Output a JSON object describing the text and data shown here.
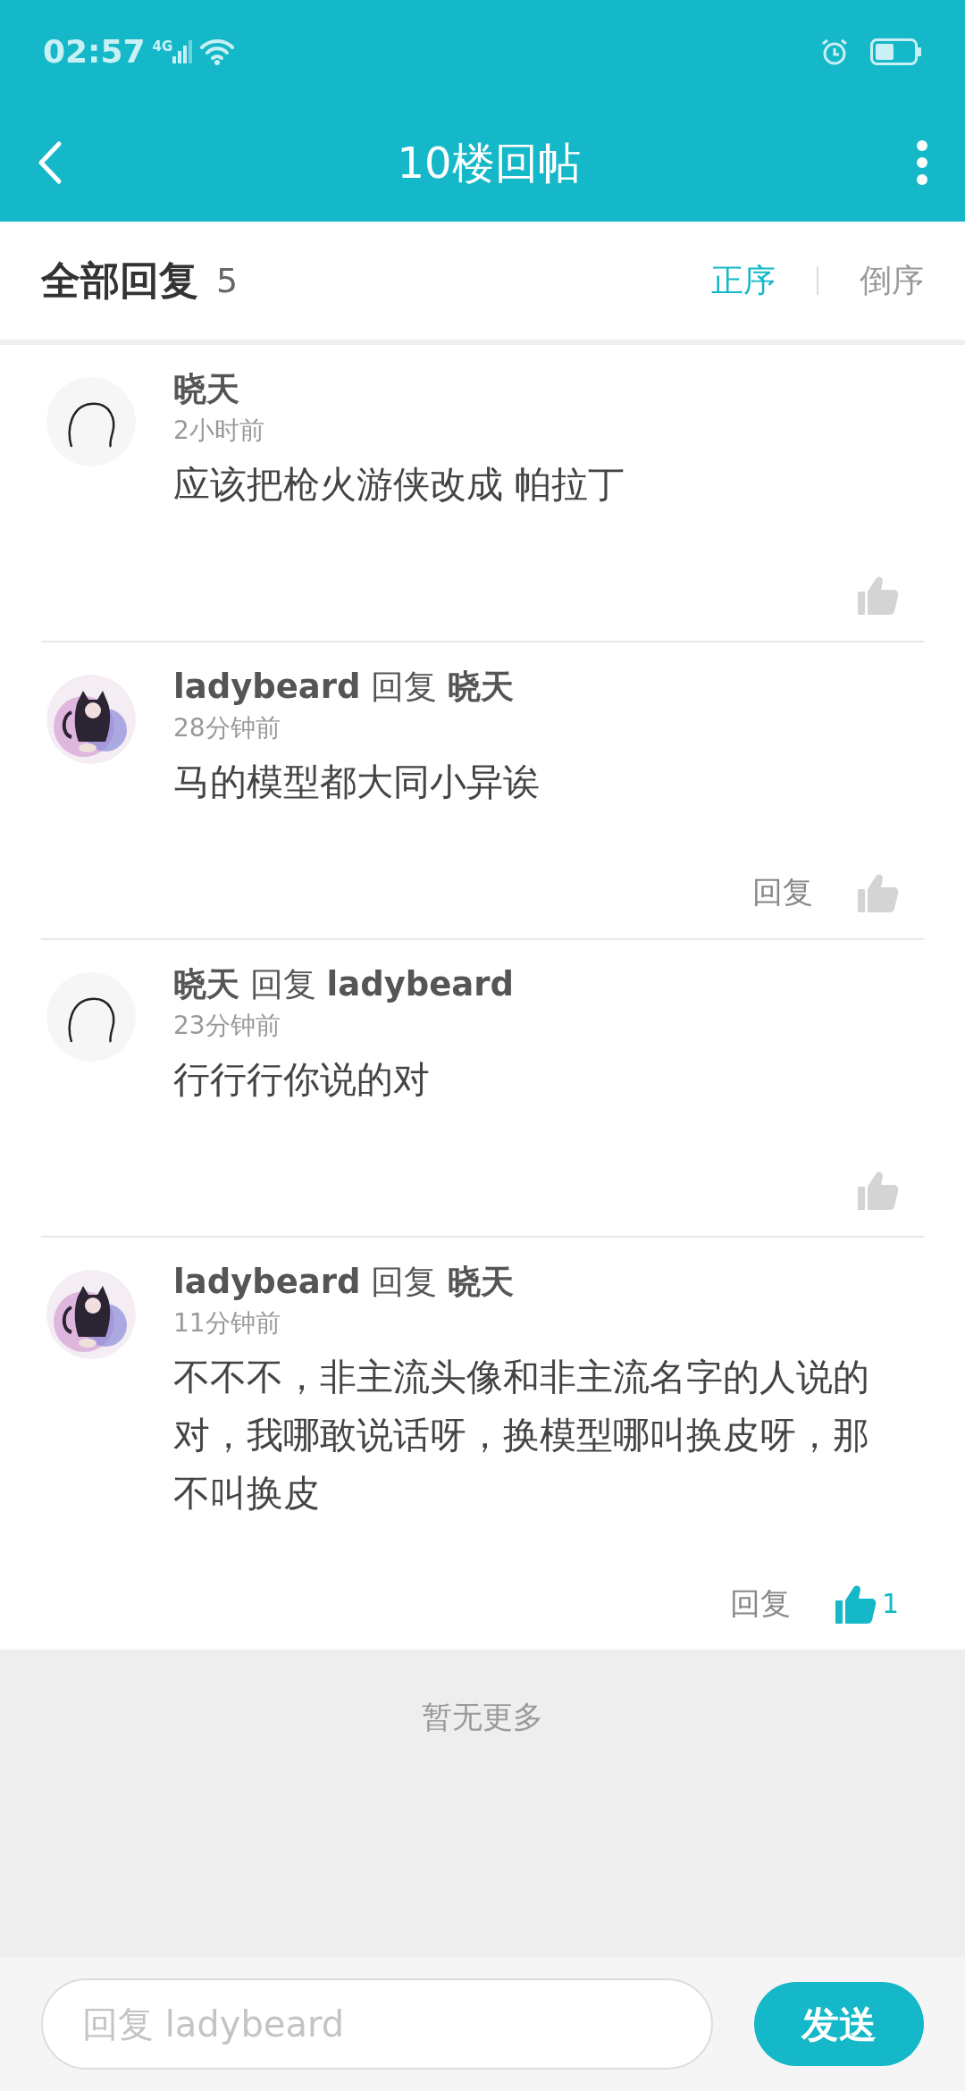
{
  "status_bar": {
    "time": "02:57",
    "network": "4G"
  },
  "app_bar": {
    "title": "10楼回帖"
  },
  "header": {
    "title": "全部回复",
    "count": "5",
    "sort_tabs": [
      {
        "label": "正序",
        "selected": true
      },
      {
        "label": "倒序",
        "selected": false
      }
    ]
  },
  "comments": [
    {
      "avatar": {
        "kind": "sketch"
      },
      "author": "晓天",
      "time": "2小时前",
      "text": "应该把枪火游侠改成  帕拉丁",
      "like": {
        "liked": false
      }
    },
    {
      "author": "ladybeard",
      "reply_word": "回复",
      "reply_to": "晓天",
      "time": "28分钟前",
      "text": "马的模型都大同小异诶",
      "reply_button": "回复",
      "like": {
        "liked": false
      }
    },
    {
      "avatar": {
        "kind": "sketch"
      },
      "author": "晓天",
      "reply_word": "回复",
      "reply_to": "ladybeard",
      "time": "23分钟前",
      "text": "行行行你说的对",
      "like": {
        "liked": false
      }
    },
    {
      "author": "ladybeard",
      "reply_word": "回复",
      "reply_to": "晓天",
      "time": "11分钟前",
      "text": "不不不，非主流头像和非主流名字的人说的对，我哪敢说话呀，换模型哪叫换皮呀，那不叫换皮",
      "reply_button": "回复",
      "like": {
        "liked": true,
        "count": "1"
      }
    }
  ],
  "end_note": "暂无更多",
  "composer": {
    "placeholder": "回复 ladybeard",
    "send": "发送"
  }
}
